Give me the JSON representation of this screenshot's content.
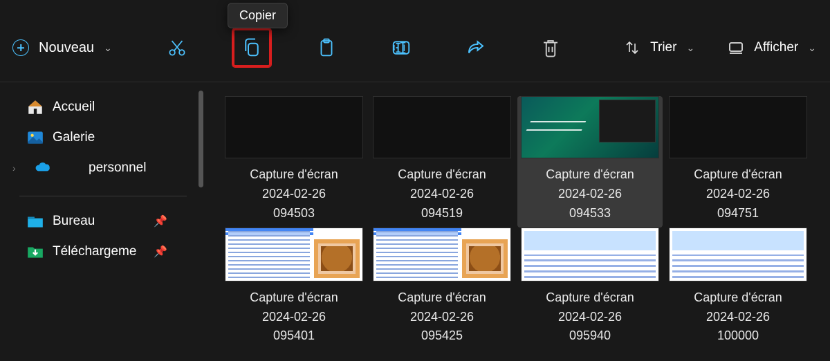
{
  "tooltip": "Copier",
  "toolbar": {
    "new_label": "Nouveau",
    "sort_label": "Trier",
    "view_label": "Afficher"
  },
  "sidebar": {
    "items": [
      {
        "icon": "home",
        "label": "Accueil"
      },
      {
        "icon": "gallery",
        "label": "Galerie"
      },
      {
        "icon": "onedrive",
        "label": "personnel",
        "expand": true
      }
    ],
    "pinned": [
      {
        "icon": "bureau",
        "label": "Bureau"
      },
      {
        "icon": "downloads",
        "label": "Téléchargeme"
      }
    ]
  },
  "files": {
    "row1": [
      {
        "thumb": "dark",
        "name": "Capture d'écran\n2024-02-26\n094503"
      },
      {
        "thumb": "dark",
        "name": "Capture d'écran\n2024-02-26\n094519"
      },
      {
        "thumb": "desktop",
        "name": "Capture d'écran\n2024-02-26\n094533",
        "selected": true
      },
      {
        "thumb": "dark",
        "name": "Capture d'écran\n2024-02-26\n094751"
      }
    ],
    "row2": [
      {
        "thumb": "lion",
        "name": "Capture d'écran\n2024-02-26\n095401"
      },
      {
        "thumb": "lion",
        "name": "Capture d'écran\n2024-02-26\n095425"
      },
      {
        "thumb": "doc",
        "name": "Capture d'écran\n2024-02-26\n095940"
      },
      {
        "thumb": "doc",
        "name": "Capture d'écran\n2024-02-26\n100000"
      }
    ]
  }
}
